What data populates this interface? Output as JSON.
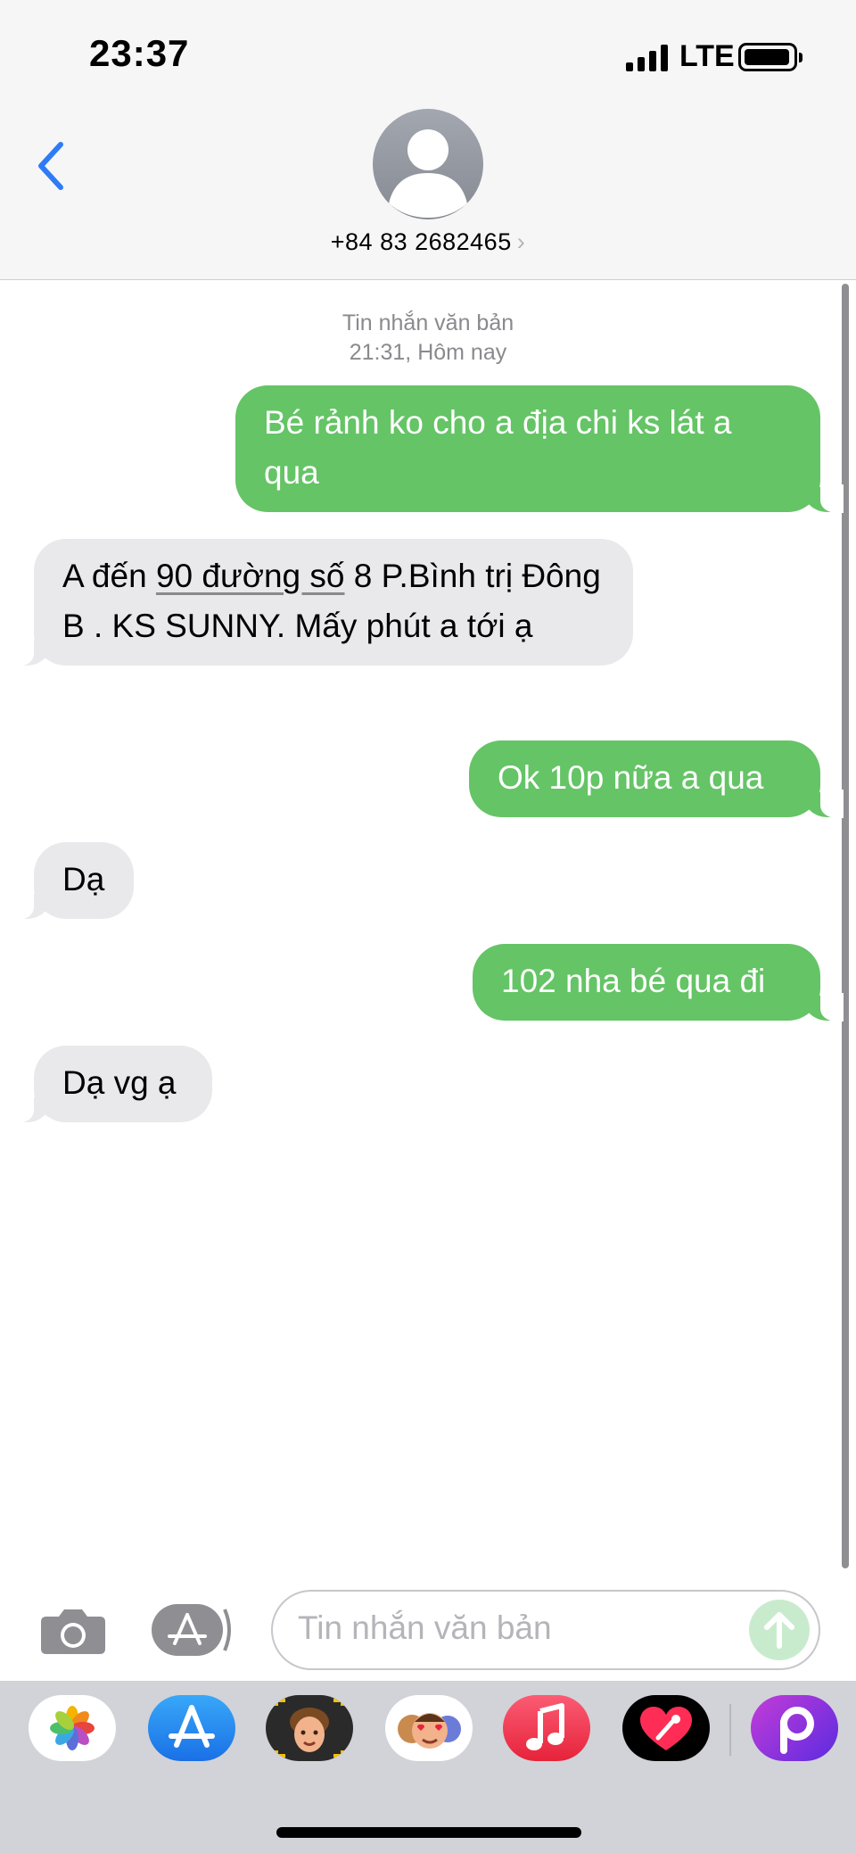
{
  "status_bar": {
    "time": "23:37",
    "network": "LTE"
  },
  "header": {
    "contact": "+84 83 2682465",
    "chevron": "›"
  },
  "conversation": {
    "meta_line1": "Tin nhắn văn bản",
    "meta_line2": "21:31, Hôm nay",
    "messages": [
      {
        "side": "sent",
        "text": "Bé rảnh ko cho a địa chi ks lát a qua"
      },
      {
        "side": "received",
        "pre": "A đến ",
        "link": "90 đường số",
        "post": " 8 P.Bình trị Đông B . KS SUNNY. Mấy phút a tới ạ"
      },
      {
        "side": "sent",
        "text": "Ok 10p nữa a qua"
      },
      {
        "side": "received",
        "text": "Dạ"
      },
      {
        "side": "sent",
        "text": "102 nha bé qua đi"
      },
      {
        "side": "received",
        "text": "Dạ vg ạ"
      }
    ]
  },
  "composer": {
    "placeholder": "Tin nhắn văn bản"
  },
  "colors": {
    "sent_bubble": "#65c466",
    "received_bubble": "#e9e9eb",
    "accent": "#2f7bf6",
    "meta_text": "#8a8a8e"
  },
  "dock": {
    "apps": [
      "photos-icon",
      "app-store-icon",
      "memoji-icon",
      "animoji-stickers-icon",
      "music-icon",
      "digital-touch-icon",
      "picsart-icon"
    ]
  }
}
